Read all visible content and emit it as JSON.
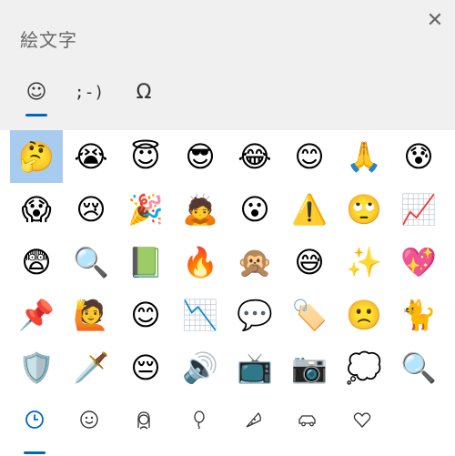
{
  "window": {
    "title": "絵文字"
  },
  "close_icon": "✕",
  "tabs": [
    {
      "name": "emoji",
      "glyph": "☺",
      "selected": true
    },
    {
      "name": "kaomoji",
      "glyph": ";-)",
      "selected": false
    },
    {
      "name": "symbols",
      "glyph": "Ω",
      "selected": false
    }
  ],
  "emoji_grid": [
    [
      "🤔",
      "😭",
      "😇",
      "😎",
      "😂",
      "😊",
      "🙏",
      "😰"
    ],
    [
      "😱",
      "😢",
      "🎉",
      "🙇",
      "😮",
      "⚠️",
      "🙄",
      "📈"
    ],
    [
      "😨",
      "🔍",
      "📗",
      "🔥",
      "🙊",
      "😅",
      "✨",
      "💖"
    ],
    [
      "📌",
      "🙋",
      "😊",
      "📉",
      "💬",
      "🏷️",
      "🙁",
      "🐈"
    ],
    [
      "🛡️",
      "🗡️",
      "😔",
      "🔊",
      "📺",
      "📷",
      "💭",
      "🔍"
    ]
  ],
  "selected_cell": {
    "row": 0,
    "col": 0
  },
  "categories": [
    {
      "name": "recent",
      "icon": "clock-icon",
      "selected": true
    },
    {
      "name": "smileys",
      "icon": "smiley-icon",
      "selected": false
    },
    {
      "name": "people",
      "icon": "person-icon",
      "selected": false
    },
    {
      "name": "celebration",
      "icon": "balloon-icon",
      "selected": false
    },
    {
      "name": "food",
      "icon": "pizza-icon",
      "selected": false
    },
    {
      "name": "travel",
      "icon": "car-icon",
      "selected": false
    },
    {
      "name": "symbols",
      "icon": "heart-icon",
      "selected": false
    }
  ],
  "colors": {
    "accent": "#0067c0",
    "header_bg": "#f0f0f0",
    "selection": "#a8ccf0"
  }
}
